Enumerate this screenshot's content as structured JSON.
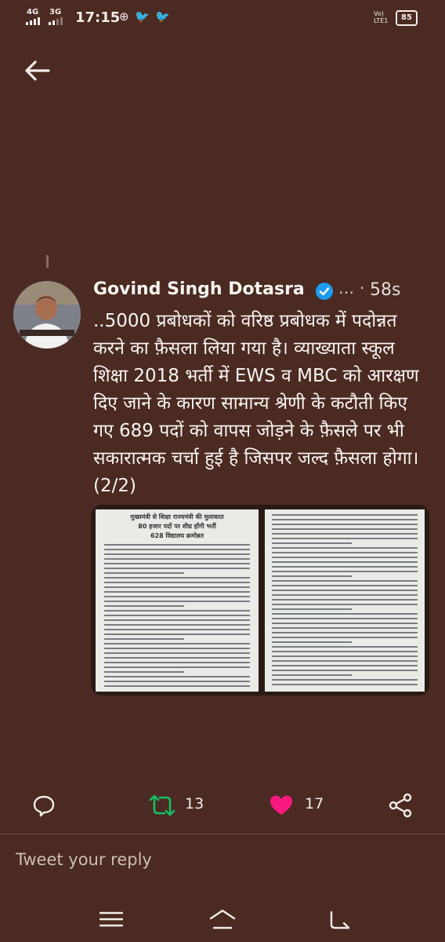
{
  "status_bar": {
    "network_1": "4G",
    "network_2": "3G",
    "time": "17:15",
    "carrier": "Vo) LTE1",
    "battery": "85"
  },
  "tweet": {
    "author_name": "Govind Singh Dotasra",
    "more": "…",
    "separator": "·",
    "time_ago": "58s",
    "text": "..5000 प्रबोधकों को वरिष्ठ प्रबोधक में पदोन्नत करने का फ़ैसला लिया गया है। व्याख्याता स्कूल शिक्षा 2018 भर्ती में EWS व MBC को आरक्षण दिए जाने के कारण सामान्य श्रेणी के कटौती किए गए 689 पदों को वापस जोड़ने के फ़ैसले पर भी सकारात्मक चर्चा हुई है जिसपर जल्द फ़ैसला होगा।(2/2)",
    "media": {
      "heading_line_1": "मुख्यमंत्री से शिक्षा राज्यमंत्री की मुलाकात",
      "heading_line_2": "80 हजार पदों पर शीघ्र होंगी भर्ती",
      "heading_line_3": "628 विद्यालय क्रमोन्नत"
    }
  },
  "actions": {
    "retweet_count": "13",
    "like_count": "17"
  },
  "reply": {
    "placeholder": "Tweet your reply"
  },
  "icons": {
    "back": "arrow-left-icon",
    "verified": "verified-badge-icon",
    "reply": "reply-bubble-icon",
    "retweet": "retweet-icon",
    "like": "heart-icon",
    "share": "share-icon"
  },
  "colors": {
    "background": "#4a2a22",
    "retweet": "#17bf63",
    "like": "#f91880",
    "verified": "#1d9bf0"
  }
}
